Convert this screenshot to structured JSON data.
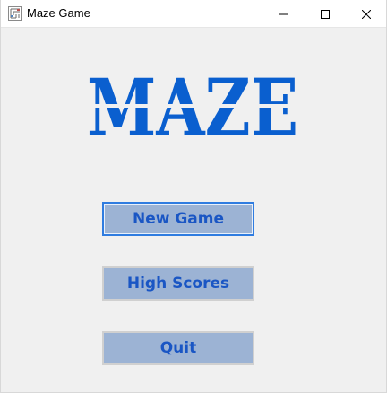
{
  "window": {
    "title": "Maze Game"
  },
  "logo": {
    "text": "MAZE",
    "color": "#0a5fcf"
  },
  "menu": {
    "new_game_label": "New Game",
    "high_scores_label": "High Scores",
    "quit_label": "Quit"
  },
  "colors": {
    "button_fill": "#9cb3d4",
    "button_text": "#1a56c4",
    "focus_border": "#2f7ce0",
    "background": "#f0f0f0"
  },
  "icons": {
    "app": "maze-app-icon",
    "minimize": "minimize-icon",
    "maximize": "maximize-icon",
    "close": "close-icon"
  }
}
